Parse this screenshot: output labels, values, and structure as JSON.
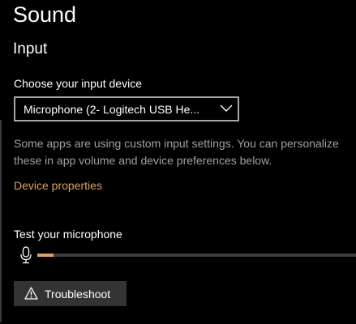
{
  "header": {
    "title": "Sound"
  },
  "input_section": {
    "title": "Input",
    "choose_label": "Choose your input device",
    "device_dropdown": {
      "selected": "Microphone (2- Logitech USB He..."
    },
    "description_lines": [
      "Some apps are using custom input settings. You can personalize",
      "these in app volume and device preferences below."
    ],
    "device_properties_link": "Device properties",
    "test_label": "Test your microphone",
    "mic_level_fraction": 0.05,
    "troubleshoot_label": "Troubleshoot"
  },
  "colors": {
    "background": "#000000",
    "accent": "#d8a561",
    "secondary_text": "#a0a0a0",
    "button_bg": "#333333",
    "track": "#3c3c3c"
  },
  "icons": {
    "dropdown": "chevron-down-icon",
    "test": "microphone-icon",
    "troubleshoot": "warning-icon"
  }
}
